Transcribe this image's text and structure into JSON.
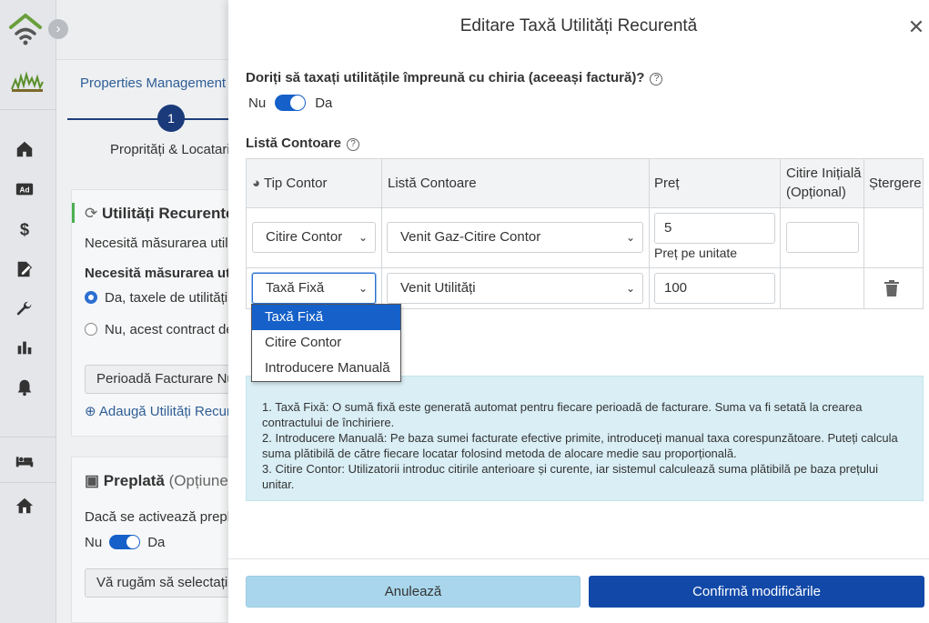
{
  "nav": {
    "icons": [
      "home-icon",
      "ad-icon",
      "dollar-icon",
      "edit-document-icon",
      "wrench-icon",
      "bar-chart-icon",
      "bell-icon",
      "bed-icon",
      "house-icon"
    ],
    "ad_text": "Ad"
  },
  "background": {
    "breadcrumb": "Properties Management N",
    "step_number": "1",
    "step_label": "Proprități & Locatari",
    "utilities_card": {
      "title": "Utilități Recurente",
      "line1": "Necesită măsurarea utilit",
      "line2": "Necesită măsurarea utili",
      "radio_yes": "Da, taxele de utilități t",
      "radio_no": "Nu, acest contract de",
      "button": "Perioadă Facturare Nu",
      "link": "Adaugă Utilități Recur"
    },
    "prepay_card": {
      "title": "Preplată",
      "optional": "(Opțiune)",
      "line1": "Dacă se activează prepla",
      "toggle_off": "Nu",
      "toggle_on": "Da",
      "select": "Vă rugăm să selectați"
    }
  },
  "modal": {
    "title": "Editare Taxă Utilități Recurentă",
    "question": "Doriți să taxați utilitățile împreună cu chiria (aceeași factură)?",
    "toggle_off": "Nu",
    "toggle_on": "Da",
    "toggle_value": "Da",
    "meters_label": "Listă Contoare",
    "table": {
      "headers": {
        "type": "Tip Contor",
        "meters": "Listă Contoare",
        "price": "Preț",
        "initial_line1": "Citire Inițială",
        "initial_line2": "(Opțional)",
        "delete": "Ștergere"
      },
      "rows": [
        {
          "type": "Citire Contor",
          "meter": "Venit Gaz-Citire Contor",
          "price": "5",
          "price_note": "Preț pe unitate",
          "initial": ""
        },
        {
          "type": "Taxă Fixă",
          "meter": "Venit Utilități",
          "price": "100"
        }
      ]
    },
    "dropdown_options": [
      "Taxă Fixă",
      "Citire Contor",
      "Introducere Manuală"
    ],
    "dropdown_selected": "Taxă Fixă",
    "info": [
      "1. Taxă Fixă: O sumă fixă este generată automat pentru fiecare perioadă de facturare. Suma va fi setată la crearea contractului de închiriere.",
      "2. Introducere Manuală: Pe baza sumei facturate efective primite, introduceți manual taxa corespunzătoare. Puteți calcula suma plătibilă de către fiecare locatar folosind metoda de alocare medie sau proporțională.",
      "3. Citire Contor: Utilizatorii introduc citirile anterioare și curente, iar sistemul calculează suma plătibilă pe baza prețului unitar."
    ],
    "cancel_label": "Anulează",
    "confirm_label": "Confirmă modificările"
  },
  "colors": {
    "primary": "#1560c9",
    "confirm": "#1249a8",
    "cancel": "#a9d6ec",
    "info_bg": "#d9eef5",
    "stepper": "#1a3a7a"
  }
}
